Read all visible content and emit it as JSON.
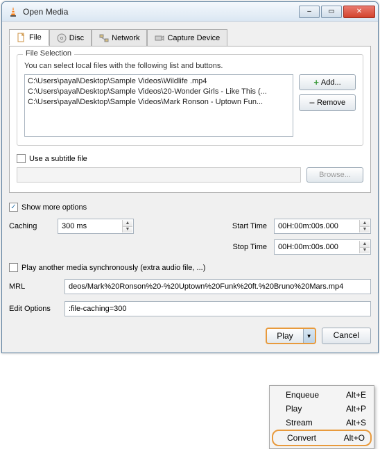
{
  "window": {
    "title": "Open Media"
  },
  "titlebar_buttons": {
    "min": "–",
    "max": "▭",
    "close": "✕"
  },
  "tabs": {
    "file": "File",
    "disc": "Disc",
    "network": "Network",
    "capture": "Capture Device"
  },
  "file_selection": {
    "group_title": "File Selection",
    "hint": "You can select local files with the following list and buttons.",
    "files": [
      "C:\\Users\\payal\\Desktop\\Sample Videos\\Wildlife .mp4",
      "C:\\Users\\payal\\Desktop\\Sample Videos\\20-Wonder Girls - Like This (...",
      "C:\\Users\\payal\\Desktop\\Sample Videos\\Mark Ronson - Uptown Fun..."
    ],
    "add_label": "Add...",
    "remove_label": "Remove"
  },
  "subtitle": {
    "checkbox_label": "Use a subtitle file",
    "browse_label": "Browse..."
  },
  "show_more_label": "Show more options",
  "options": {
    "caching_label": "Caching",
    "caching_value": "300 ms",
    "start_label": "Start Time",
    "start_value": "00H:00m:00s.000",
    "stop_label": "Stop Time",
    "stop_value": "00H:00m:00s.000",
    "play_another_label": "Play another media synchronously (extra audio file, ...)",
    "mrl_label": "MRL",
    "mrl_value": "deos/Mark%20Ronson%20-%20Uptown%20Funk%20ft.%20Bruno%20Mars.mp4",
    "edit_label": "Edit Options",
    "edit_value": ":file-caching=300"
  },
  "buttons": {
    "play": "Play",
    "cancel": "Cancel"
  },
  "menu": {
    "enqueue": {
      "label": "Enqueue",
      "shortcut": "Alt+E"
    },
    "play": {
      "label": "Play",
      "shortcut": "Alt+P"
    },
    "stream": {
      "label": "Stream",
      "shortcut": "Alt+S"
    },
    "convert": {
      "label": "Convert",
      "shortcut": "Alt+O"
    }
  }
}
